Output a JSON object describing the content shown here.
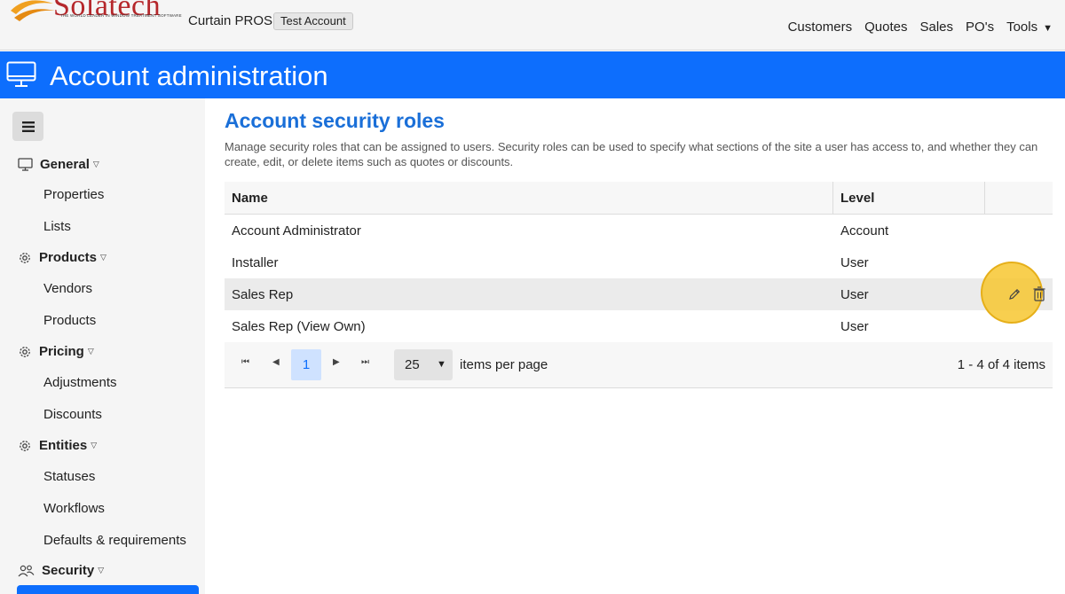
{
  "brand": {
    "logo_word": "Solatech",
    "logo_tagline": "THE WORLD LEADER IN WINDOW TREATMENT SOFTWARE",
    "logo_color": "#b5272b"
  },
  "topbar": {
    "app_name": "Curtain PROS",
    "account_badge": "Test Account",
    "nav": [
      "Customers",
      "Quotes",
      "Sales",
      "PO's",
      "Tools"
    ]
  },
  "header": {
    "icon": "monitor-icon",
    "title": "Account administration",
    "color": "#0d6efd"
  },
  "sidebar": {
    "toggle_icon": "hamburger-icon",
    "groups": [
      {
        "label": "General",
        "icon": "monitor-icon",
        "items": [
          "Properties",
          "Lists"
        ]
      },
      {
        "label": "Products",
        "icon": "gear-icon",
        "items": [
          "Vendors",
          "Products"
        ]
      },
      {
        "label": "Pricing",
        "icon": "gear-icon",
        "items": [
          "Adjustments",
          "Discounts"
        ]
      },
      {
        "label": "Entities",
        "icon": "gear-icon",
        "items": [
          "Statuses",
          "Workflows",
          "Defaults & requirements"
        ]
      },
      {
        "label": "Security",
        "icon": "users-icon",
        "items": []
      }
    ]
  },
  "main": {
    "title": "Account security roles",
    "description": "Manage security roles that can be assigned to users. Security roles can be used to specify what sections of the site a user has access to, and whether they can create, edit, or delete items such as quotes or discounts.",
    "columns": {
      "name": "Name",
      "level": "Level"
    },
    "rows": [
      {
        "name": "Account Administrator",
        "level": "Account"
      },
      {
        "name": "Installer",
        "level": "User"
      },
      {
        "name": "Sales Rep",
        "level": "User"
      },
      {
        "name": "Sales Rep (View Own)",
        "level": "User"
      }
    ],
    "highlighted_row": "Sales Rep",
    "pager": {
      "current_page": "1",
      "page_size": "25",
      "page_size_label": "items per page",
      "info": "1 - 4 of 4 items"
    }
  }
}
